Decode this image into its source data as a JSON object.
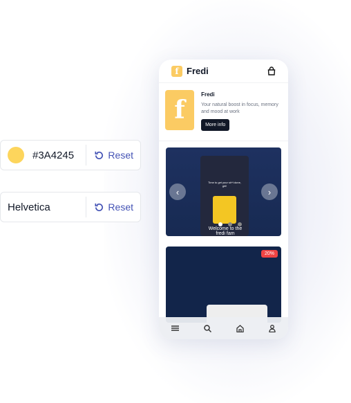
{
  "color_setting": {
    "value": "#3A4245",
    "swatch_color": "#fdd55c",
    "reset_label": "Reset"
  },
  "font_setting": {
    "value": "Helvetica",
    "reset_label": "Reset"
  },
  "app": {
    "brand": "Fredi",
    "logo_letter": "f",
    "hero": {
      "title": "Fredi",
      "description": "Your natural boost in focus, memory and mood at work",
      "button": "More info"
    },
    "carousel": {
      "top_text": "Time to get your sh*t done, girl!",
      "bottom_text": "Welcome to the fredi fam",
      "slides": 3,
      "active_slide": 1
    },
    "product": {
      "badge": "20%"
    },
    "nav": [
      "menu",
      "search",
      "home",
      "account"
    ]
  }
}
